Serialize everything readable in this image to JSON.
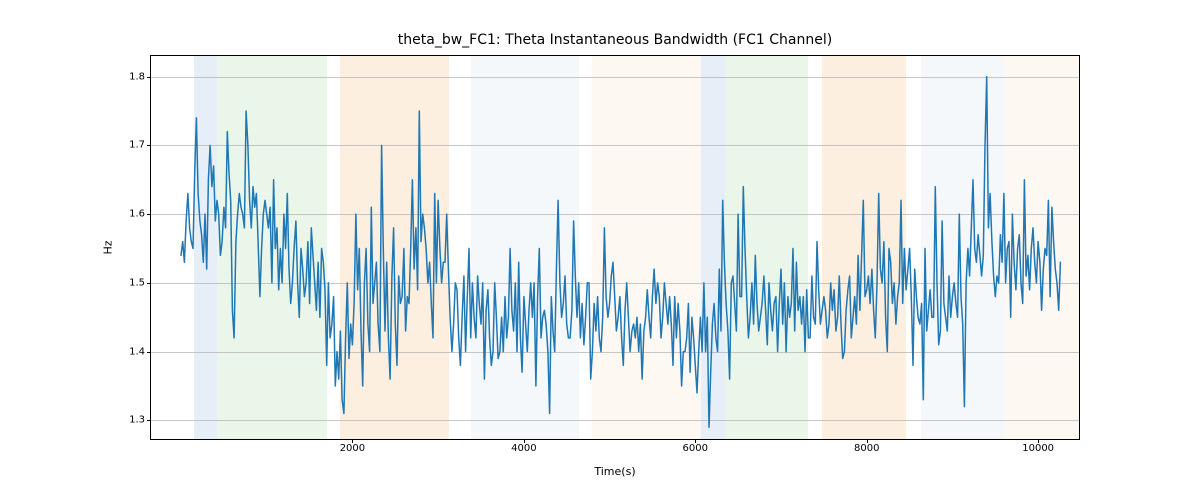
{
  "chart_data": {
    "type": "line",
    "title": "theta_bw_FC1: Theta Instantaneous Bandwidth (FC1 Channel)",
    "xlabel": "Time(s)",
    "ylabel": "Hz",
    "xlim": [
      -350,
      10500
    ],
    "ylim": [
      1.27,
      1.83
    ],
    "x_ticks": [
      2000,
      4000,
      6000,
      8000,
      10000
    ],
    "y_ticks": [
      1.3,
      1.4,
      1.5,
      1.6,
      1.7,
      1.8
    ],
    "bands": [
      {
        "x0": 150,
        "x1": 420,
        "color": "#a7c4e2"
      },
      {
        "x0": 420,
        "x1": 1700,
        "color": "#b7e0b7"
      },
      {
        "x0": 1860,
        "x1": 3130,
        "color": "#f4c58d"
      },
      {
        "x0": 3380,
        "x1": 4640,
        "color": "#d9e5f1"
      },
      {
        "x0": 4800,
        "x1": 6070,
        "color": "#fbe7cf"
      },
      {
        "x0": 6070,
        "x1": 6350,
        "color": "#a7c4e2"
      },
      {
        "x0": 6350,
        "x1": 7320,
        "color": "#b7e0b7"
      },
      {
        "x0": 7480,
        "x1": 8460,
        "color": "#f4c58d"
      },
      {
        "x0": 8630,
        "x1": 9600,
        "color": "#d9e5f1"
      },
      {
        "x0": 9600,
        "x1": 10500,
        "color": "#fbe7cf"
      }
    ],
    "series": [
      {
        "name": "theta_bw_FC1",
        "color": "#1f77b4",
        "x_step": 20,
        "x_start": 0,
        "values": [
          1.54,
          1.56,
          1.53,
          1.59,
          1.63,
          1.58,
          1.56,
          1.55,
          1.66,
          1.74,
          1.63,
          1.59,
          1.57,
          1.53,
          1.6,
          1.52,
          1.65,
          1.7,
          1.64,
          1.67,
          1.59,
          1.62,
          1.6,
          1.54,
          1.56,
          1.61,
          1.58,
          1.72,
          1.66,
          1.62,
          1.46,
          1.42,
          1.56,
          1.6,
          1.63,
          1.61,
          1.6,
          1.58,
          1.75,
          1.7,
          1.62,
          1.58,
          1.64,
          1.61,
          1.63,
          1.56,
          1.48,
          1.55,
          1.6,
          1.62,
          1.6,
          1.58,
          1.61,
          1.5,
          1.65,
          1.55,
          1.58,
          1.49,
          1.55,
          1.5,
          1.6,
          1.55,
          1.63,
          1.52,
          1.47,
          1.5,
          1.55,
          1.59,
          1.5,
          1.45,
          1.55,
          1.52,
          1.48,
          1.5,
          1.56,
          1.47,
          1.58,
          1.54,
          1.5,
          1.46,
          1.53,
          1.45,
          1.55,
          1.53,
          1.49,
          1.38,
          1.5,
          1.42,
          1.44,
          1.48,
          1.35,
          1.4,
          1.36,
          1.43,
          1.33,
          1.31,
          1.42,
          1.5,
          1.39,
          1.44,
          1.41,
          1.47,
          1.6,
          1.49,
          1.55,
          1.43,
          1.35,
          1.5,
          1.55,
          1.44,
          1.4,
          1.61,
          1.47,
          1.5,
          1.53,
          1.44,
          1.4,
          1.7,
          1.55,
          1.43,
          1.53,
          1.42,
          1.36,
          1.51,
          1.58,
          1.44,
          1.38,
          1.51,
          1.47,
          1.48,
          1.55,
          1.43,
          1.48,
          1.47,
          1.55,
          1.65,
          1.52,
          1.58,
          1.49,
          1.75,
          1.56,
          1.6,
          1.58,
          1.55,
          1.5,
          1.53,
          1.47,
          1.42,
          1.63,
          1.5,
          1.62,
          1.55,
          1.5,
          1.53,
          1.53,
          1.6,
          1.52,
          1.45,
          1.4,
          1.44,
          1.5,
          1.49,
          1.42,
          1.38,
          1.45,
          1.51,
          1.4,
          1.48,
          1.55,
          1.42,
          1.5,
          1.45,
          1.42,
          1.51,
          1.47,
          1.44,
          1.5,
          1.36,
          1.46,
          1.49,
          1.42,
          1.38,
          1.4,
          1.5,
          1.45,
          1.39,
          1.4,
          1.45,
          1.4,
          1.48,
          1.42,
          1.45,
          1.55,
          1.46,
          1.43,
          1.5,
          1.4,
          1.53,
          1.42,
          1.37,
          1.48,
          1.44,
          1.4,
          1.46,
          1.5,
          1.45,
          1.5,
          1.35,
          1.48,
          1.55,
          1.42,
          1.45,
          1.46,
          1.44,
          1.4,
          1.31,
          1.48,
          1.43,
          1.4,
          1.52,
          1.62,
          1.5,
          1.45,
          1.47,
          1.51,
          1.44,
          1.42,
          1.42,
          1.46,
          1.59,
          1.51,
          1.45,
          1.5,
          1.42,
          1.47,
          1.41,
          1.45,
          1.5,
          1.5,
          1.36,
          1.4,
          1.47,
          1.43,
          1.48,
          1.42,
          1.4,
          1.45,
          1.58,
          1.48,
          1.45,
          1.47,
          1.51,
          1.53,
          1.48,
          1.43,
          1.45,
          1.48,
          1.42,
          1.38,
          1.46,
          1.5,
          1.45,
          1.4,
          1.43,
          1.44,
          1.42,
          1.45,
          1.4,
          1.44,
          1.36,
          1.43,
          1.45,
          1.49,
          1.45,
          1.42,
          1.48,
          1.52,
          1.47,
          1.5,
          1.48,
          1.42,
          1.45,
          1.5,
          1.47,
          1.44,
          1.48,
          1.44,
          1.38,
          1.48,
          1.42,
          1.47,
          1.43,
          1.35,
          1.4,
          1.4,
          1.42,
          1.47,
          1.37,
          1.45,
          1.42,
          1.38,
          1.34,
          1.4,
          1.45,
          1.4,
          1.5,
          1.4,
          1.45,
          1.29,
          1.37,
          1.44,
          1.47,
          1.42,
          1.4,
          1.52,
          1.43,
          1.62,
          1.53,
          1.47,
          1.43,
          1.36,
          1.5,
          1.51,
          1.47,
          1.43,
          1.6,
          1.48,
          1.48,
          1.64,
          1.55,
          1.48,
          1.42,
          1.45,
          1.5,
          1.44,
          1.54,
          1.47,
          1.43,
          1.45,
          1.47,
          1.51,
          1.46,
          1.41,
          1.5,
          1.46,
          1.43,
          1.47,
          1.48,
          1.4,
          1.47,
          1.52,
          1.44,
          1.5,
          1.4,
          1.48,
          1.45,
          1.47,
          1.55,
          1.43,
          1.53,
          1.46,
          1.48,
          1.44,
          1.48,
          1.4,
          1.49,
          1.42,
          1.42,
          1.51,
          1.45,
          1.44,
          1.56,
          1.49,
          1.44,
          1.46,
          1.48,
          1.46,
          1.42,
          1.44,
          1.5,
          1.46,
          1.49,
          1.43,
          1.45,
          1.51,
          1.44,
          1.39,
          1.4,
          1.46,
          1.49,
          1.51,
          1.42,
          1.45,
          1.48,
          1.44,
          1.54,
          1.46,
          1.54,
          1.62,
          1.48,
          1.49,
          1.51,
          1.47,
          1.52,
          1.46,
          1.42,
          1.5,
          1.63,
          1.52,
          1.5,
          1.56,
          1.45,
          1.4,
          1.55,
          1.53,
          1.47,
          1.5,
          1.44,
          1.48,
          1.5,
          1.62,
          1.47,
          1.55,
          1.49,
          1.52,
          1.55,
          1.48,
          1.38,
          1.52,
          1.48,
          1.45,
          1.44,
          1.47,
          1.33,
          1.55,
          1.43,
          1.46,
          1.49,
          1.45,
          1.45,
          1.64,
          1.5,
          1.41,
          1.43,
          1.59,
          1.47,
          1.45,
          1.43,
          1.51,
          1.45,
          1.48,
          1.5,
          1.47,
          1.45,
          1.6,
          1.48,
          1.44,
          1.32,
          1.5,
          1.55,
          1.51,
          1.58,
          1.65,
          1.55,
          1.53,
          1.57,
          1.54,
          1.51,
          1.54,
          1.7,
          1.8,
          1.58,
          1.63,
          1.56,
          1.51,
          1.48,
          1.51,
          1.5,
          1.57,
          1.53,
          1.63,
          1.5,
          1.55,
          1.56,
          1.45,
          1.6,
          1.53,
          1.49,
          1.55,
          1.57,
          1.5,
          1.47,
          1.65,
          1.51,
          1.54,
          1.49,
          1.55,
          1.58,
          1.53,
          1.5,
          1.56,
          1.53,
          1.46,
          1.52,
          1.55,
          1.54,
          1.62,
          1.48,
          1.61,
          1.56,
          1.52,
          1.5,
          1.46,
          1.53
        ]
      }
    ]
  }
}
